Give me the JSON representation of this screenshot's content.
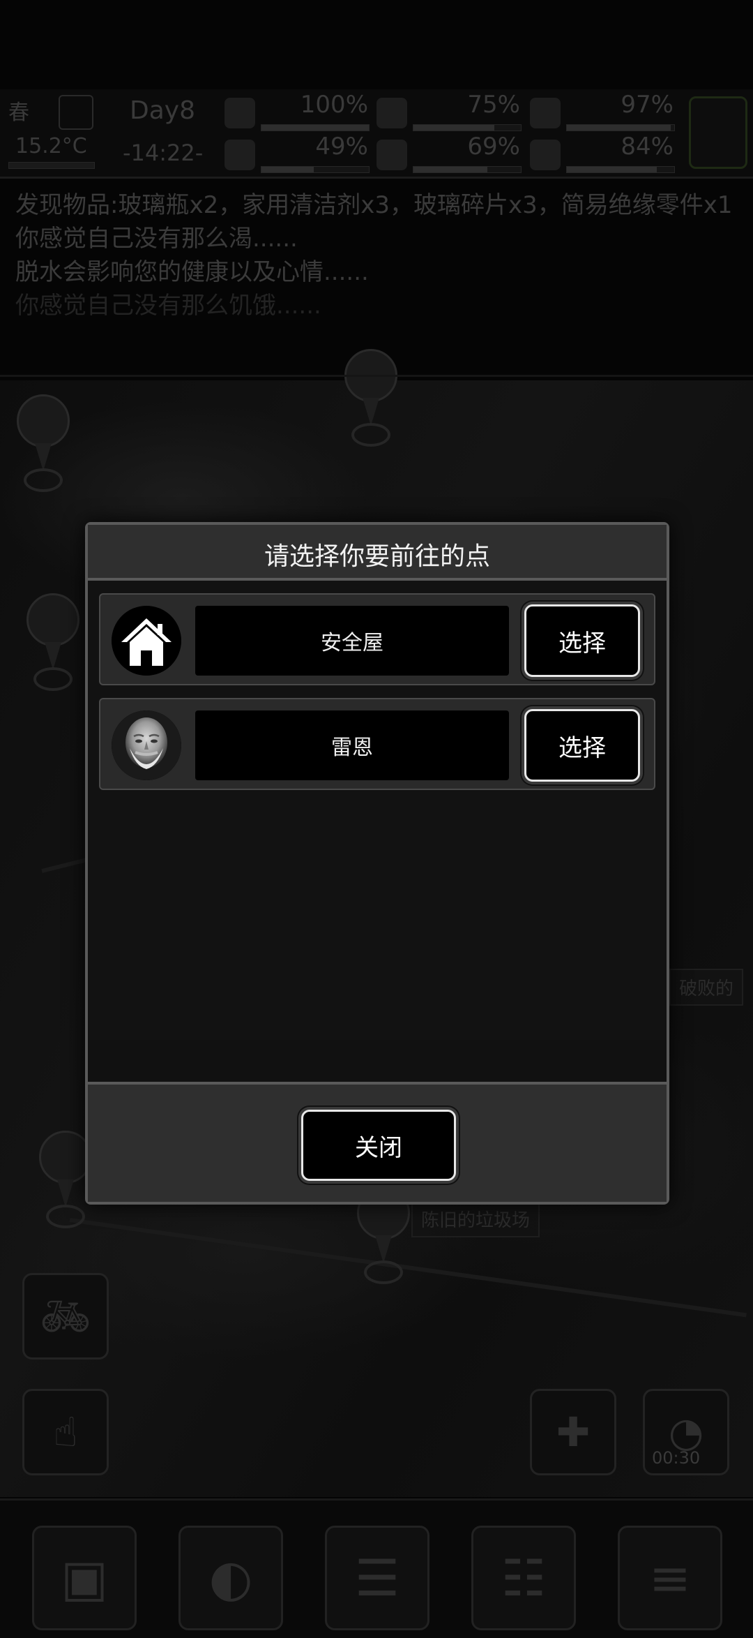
{
  "hud": {
    "season": "春",
    "temperature": "15.2°C",
    "day": "Day8",
    "time": "-14:22-",
    "stats": [
      {
        "name": "health",
        "value": "100%",
        "level": 1.0
      },
      {
        "name": "hunger",
        "value": "75%",
        "level": 0.75
      },
      {
        "name": "stamina",
        "value": "97%",
        "level": 0.97
      },
      {
        "name": "fatigue",
        "value": "49%",
        "level": 0.49
      },
      {
        "name": "thirst",
        "value": "69%",
        "level": 0.69
      },
      {
        "name": "mood",
        "value": "84%",
        "level": 0.84
      }
    ]
  },
  "log": {
    "lines": [
      "发现物品:玻璃瓶x2，家用清洁剂x3，玻璃碎片x3，简易绝缘零件x1",
      "你感觉自己没有那么渴......",
      "脱水会影响您的健康以及心情......",
      "你感觉自己没有那么饥饿......"
    ]
  },
  "map": {
    "labels": [
      "破败的",
      "陈旧的垃圾场"
    ]
  },
  "timer": "00:30",
  "modal": {
    "title": "请选择你要前往的点",
    "items": [
      {
        "name": "安全屋",
        "choose_label": "选择",
        "icon": "house-icon"
      },
      {
        "name": "雷恩",
        "choose_label": "选择",
        "icon": "portrait-avatar"
      }
    ],
    "close_label": "关闭"
  },
  "colors": {
    "modal_header": "#2f2f2f",
    "modal_border": "#5a5a5a",
    "button_bg": "#000000",
    "button_border": "#e8e8e8"
  }
}
